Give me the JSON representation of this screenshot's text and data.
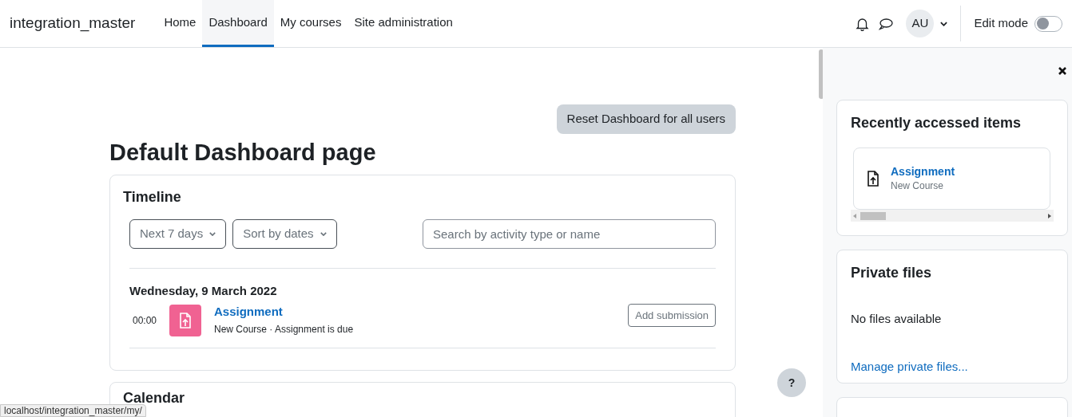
{
  "navbar": {
    "site_name": "integration_master",
    "nav_items": [
      {
        "label": "Home",
        "selected": false
      },
      {
        "label": "Dashboard",
        "selected": true
      },
      {
        "label": "My courses",
        "selected": false
      },
      {
        "label": "Site administration",
        "selected": false
      }
    ],
    "avatar_initials": "AU",
    "edit_mode": {
      "label": "Edit mode",
      "on": false
    }
  },
  "main": {
    "reset_button": "Reset Dashboard for all users",
    "title": "Default Dashboard page",
    "timeline": {
      "title": "Timeline",
      "filter": "Next 7 days",
      "sort": "Sort by dates",
      "search": {
        "placeholder": "Search by activity type or name"
      },
      "days": [
        {
          "date": "Wednesday, 9 March 2022",
          "events": [
            {
              "time": "00:00",
              "name": "Assignment",
              "details": "New Course · Assignment is due",
              "action": "Add submission"
            }
          ]
        }
      ]
    },
    "calendar": {
      "title": "Calendar"
    }
  },
  "drawer": {
    "blocks": [
      {
        "kind": "recent",
        "title": "Recently accessed items",
        "items": [
          {
            "name": "Assignment",
            "course": "New Course"
          }
        ]
      },
      {
        "kind": "files",
        "title": "Private files",
        "message": "No files available",
        "link": "Manage private files..."
      },
      {
        "kind": "badges"
      }
    ]
  },
  "help_button": "?",
  "status_bar": "localhost/integration_master/my/"
}
